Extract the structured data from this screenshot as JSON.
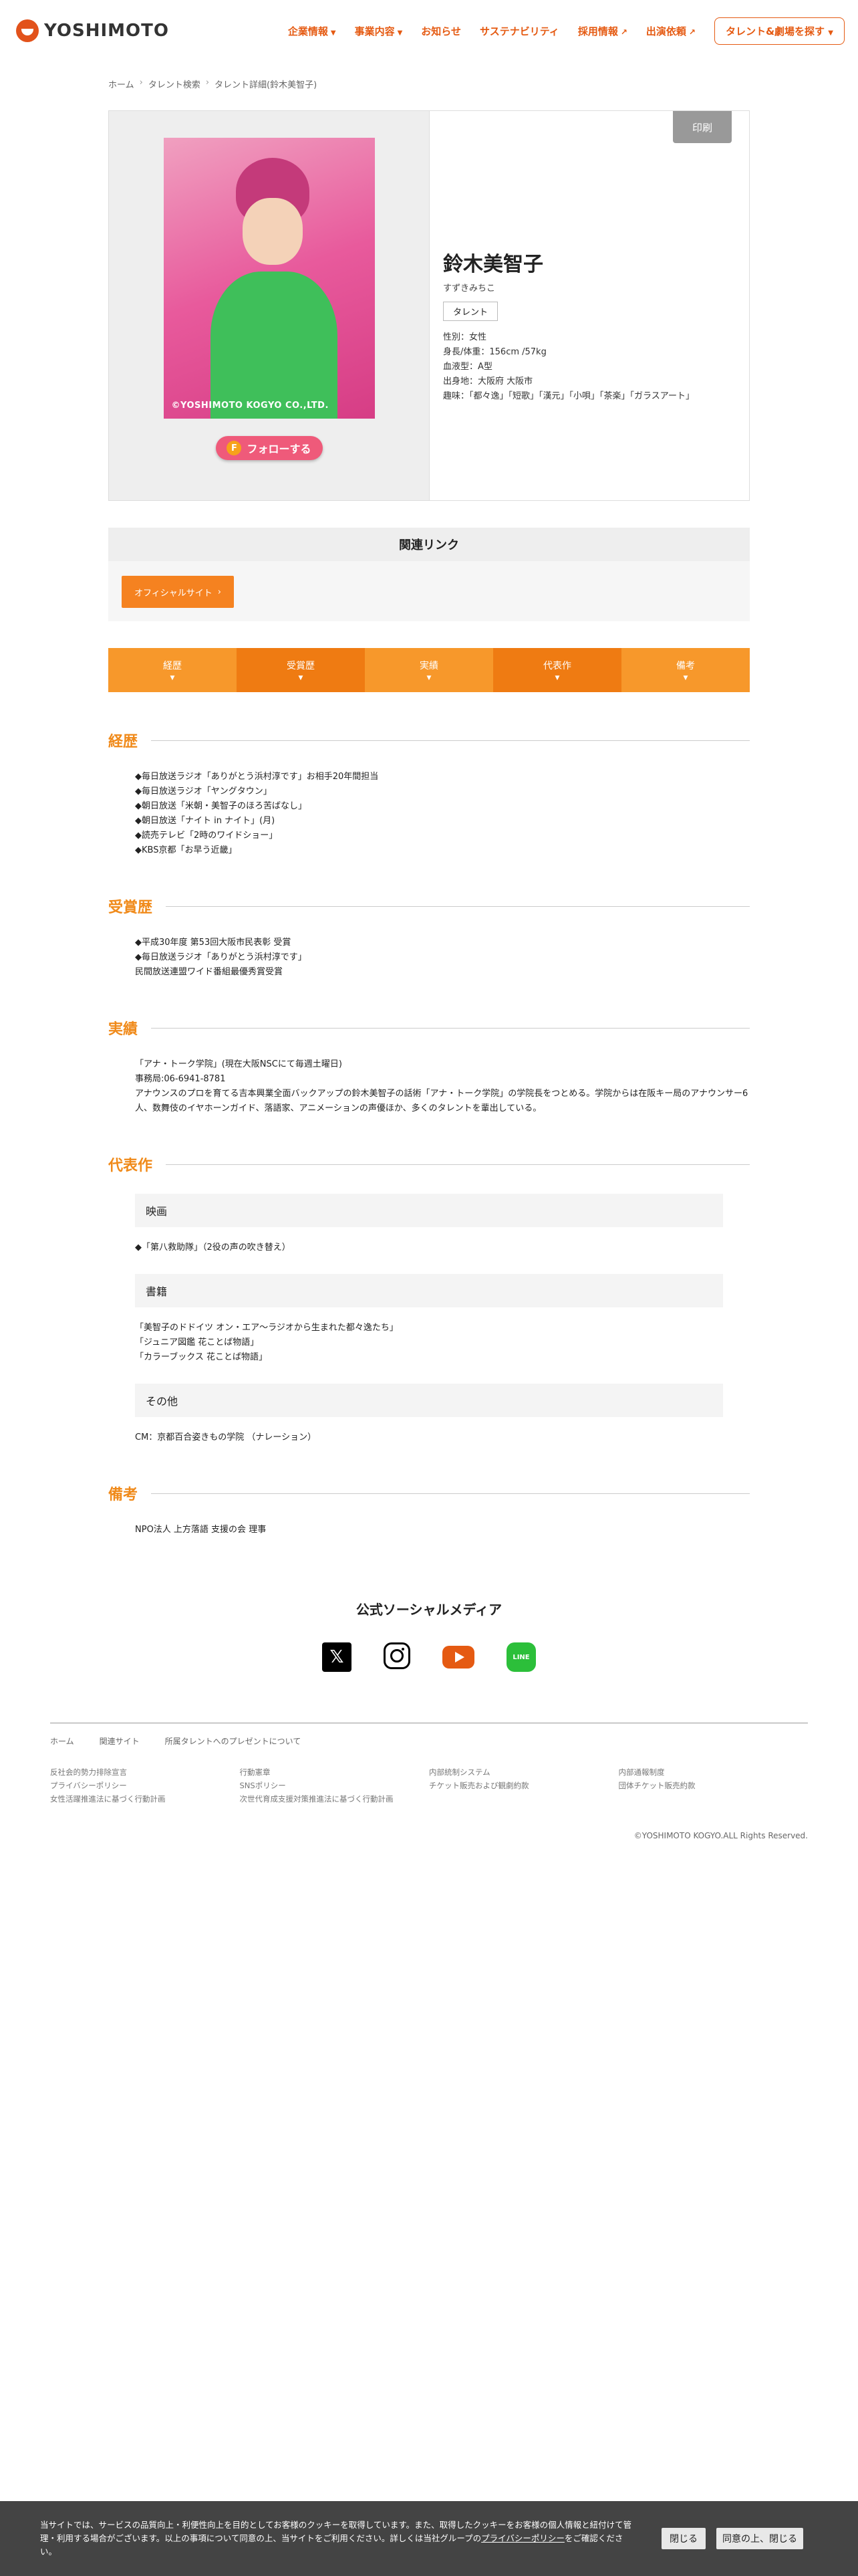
{
  "header": {
    "logo": "YOSHIMOTO",
    "nav": [
      {
        "label": "企業情報",
        "icon": "chevron-down"
      },
      {
        "label": "事業内容",
        "icon": "chevron-down"
      },
      {
        "label": "お知らせ",
        "icon": ""
      },
      {
        "label": "サステナビリティ",
        "icon": ""
      },
      {
        "label": "採用情報",
        "icon": "external-link"
      },
      {
        "label": "出演依頼",
        "icon": "external-link"
      }
    ],
    "search_button": "タレント&劇場を探す"
  },
  "breadcrumb": [
    "ホーム",
    "タレント検索",
    "タレント詳細(鈴木美智子)"
  ],
  "profile": {
    "photo_credit": "©YOSHIMOTO KOGYO CO.,LTD.",
    "follow_label": "フォローする",
    "print_label": "印刷",
    "name": "鈴木美智子",
    "kana": "すずきみちこ",
    "tag": "タレント",
    "details": [
      "性別：女性",
      "身長/体重：156cm /57kg",
      "血液型：A型",
      "出身地：大阪府 大阪市",
      "趣味：「都々逸」「短歌」「漢元」「小唄」「茶楽」「ガラスアート」"
    ]
  },
  "related": {
    "title": "関連リンク",
    "button": "オフィシャルサイト"
  },
  "tabs": [
    "経歴",
    "受賞歴",
    "実績",
    "代表作",
    "備考"
  ],
  "sections": {
    "career": {
      "title": "経歴",
      "lines": [
        "◆毎日放送ラジオ「ありがとう浜村淳です」お相手20年間担当",
        "◆毎日放送ラジオ「ヤングタウン」",
        "◆朝日放送「米朝・美智子のほろ苦ばなし」",
        "◆朝日放送「ナイト in ナイト」(月)",
        "◆読売テレビ「2時のワイドショー」",
        "◆KBS京都「お早う近畿」"
      ]
    },
    "awards": {
      "title": "受賞歴",
      "lines": [
        "◆平成30年度 第53回大阪市民表彰 受賞",
        "◆毎日放送ラジオ「ありがとう浜村淳です」",
        "民間放送連盟ワイド番組最優秀賞受賞"
      ]
    },
    "achievements": {
      "title": "実績",
      "lines": [
        "「アナ・トーク学院」(現在大阪NSCにて毎週土曜日)",
        "事務局:06-6941-8781",
        "アナウンスのプロを育てる吉本興業全面バックアップの鈴木美智子の話術「アナ・トーク学院」の学院長をつとめる。学院からは在阪キー局のアナウンサー6人、数舞伎のイヤホーンガイド、落語家、アニメーションの声優ほか、多くのタレントを輩出している。"
      ]
    },
    "works": {
      "title": "代表作",
      "groups": [
        {
          "label": "映画",
          "lines": [
            "◆「第八救助隊」（2役の声の吹き替え）"
          ]
        },
        {
          "label": "書籍",
          "lines": [
            "「美智子のドドイツ オン・エア〜ラジオから生まれた都々逸たち」",
            "「ジュニア図鑑 花ことば物語」",
            "「カラーブックス 花ことば物語」"
          ]
        },
        {
          "label": "その他",
          "lines": [
            "CM：京都百合姿きもの学院 （ナレーション）"
          ]
        }
      ]
    },
    "notes": {
      "title": "備考",
      "lines": [
        "NPO法人 上方落語 支援の会 理事"
      ]
    }
  },
  "social": {
    "title": "公式ソーシャルメディア",
    "icons": [
      "x-icon",
      "instagram-icon",
      "youtube-icon",
      "line-icon"
    ],
    "line_text": "LINE"
  },
  "footer": {
    "links": [
      "ホーム",
      "関連サイト",
      "所属タレントへのプレゼントについて"
    ],
    "columns": [
      [
        "反社会的勢力排除宣言",
        "プライバシーポリシー",
        "女性活躍推進法に基づく行動計画"
      ],
      [
        "行動憲章",
        "SNSポリシー",
        "次世代育成支援対策推進法に基づく行動計画"
      ],
      [
        "内部統制システム",
        "チケット販売および観劇約款"
      ],
      [
        "内部通報制度",
        "団体チケット販売約款"
      ]
    ],
    "copyright": "©YOSHIMOTO KOGYO.ALL Rights Reserved."
  },
  "cookie": {
    "text_before": "当サイトでは、サービスの品質向上・利便性向上を目的としてお客様のクッキーを取得しています。また、取得したクッキーをお客様の個人情報と紐付けて管理・利用する場合がございます。以上の事項について同意の上、当サイトをご利用ください。詳しくは当社グループの",
    "link": "プライバシーポリシー",
    "text_after": "をご確認ください。",
    "close": "閉じる",
    "agree": "同意の上、閉じる"
  }
}
